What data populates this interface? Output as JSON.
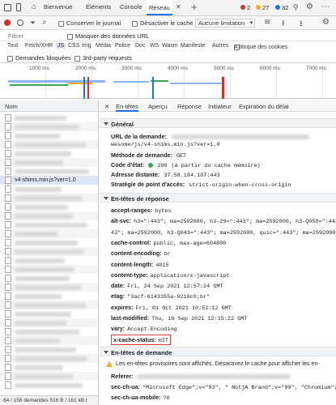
{
  "topbar": {
    "tabs": [
      "Bienvenue",
      "Éléments",
      "Console",
      "Réseau"
    ],
    "active_tab": "Réseau",
    "errors": "2",
    "warnings": "27",
    "info": "32"
  },
  "toolbar": {
    "preserve_log": "Conserver le journal",
    "disable_cache": "Désactiver le cache",
    "throttle": "Aucune limitation"
  },
  "filter": {
    "placeholder": "Filtrer",
    "hide_data_urls": "Masquer des données URL"
  },
  "types": [
    "Tout",
    "Fetch/XHR",
    "JS",
    "CSS",
    "Img",
    "Média",
    "Police",
    "Doc",
    "WS",
    "Wasm",
    "Manifeste",
    "Autres"
  ],
  "types_selected": "JS",
  "blocked_cookies": "A bloqué des cookies",
  "blocked_requests": "Demandes bloquées",
  "third_party": "3rd-party requests",
  "timeline": {
    "labels": [
      "1000 ms",
      "2000 ms",
      "3000 ms",
      "4000 ms",
      "5000 ms",
      "6000 ms",
      "7000 ms"
    ]
  },
  "left": {
    "column_header": "Nom",
    "selected_file": "v4-shims.min.js?ver=1.0",
    "status": "64 / 156 demandes   516 B / 161 kB t"
  },
  "right": {
    "tabs": [
      "En-têtes",
      "Aperçu",
      "Réponse",
      "Initiateur",
      "Expiration du délai"
    ],
    "active_tab": "En-têtes",
    "general": {
      "title": "Général",
      "url_label": "URL de la demande:",
      "url_value": "wesome/js/v4-shims.min.js?ver=1.0",
      "method_label": "Méthode de demande:",
      "method_value": "GET",
      "status_label": "Code d'état:",
      "status_code": "200",
      "status_note": "(à partir du cache mémoire)",
      "remote_label": "Adresse distante:",
      "remote_value": "37.58.184.107:443",
      "referrer_label": "Stratégie de point d'accès:",
      "referrer_value": "strict-origin-when-cross-origin"
    },
    "response": {
      "title": "En-têtes de réponse",
      "headers": [
        {
          "k": "accept-ranges:",
          "v": "bytes"
        },
        {
          "k": "alt-svc:",
          "v": "h3=\":443\"; ma=2592000, h3-29=\":443\"; ma=2592000, h3-Q050=\":443\"; ma=2"
        },
        {
          "k": "",
          "v": "43\"; ma=2592000, h3-Q043=\":443\"; ma=2592000, quic=\":443\"; ma=2592000; v=\"46,4"
        },
        {
          "k": "cache-control:",
          "v": "public, max-age=604800"
        },
        {
          "k": "content-encoding:",
          "v": "br"
        },
        {
          "k": "content-length:",
          "v": "4015"
        },
        {
          "k": "content-type:",
          "v": "application/x-javascript"
        },
        {
          "k": "date:",
          "v": "Fri, 24 Sep 2021 12:57:24 GMT"
        },
        {
          "k": "etag:",
          "v": "\"3acf-6143355a-9216c0;br\""
        },
        {
          "k": "expires:",
          "v": "Fri, 01 Oct 2021 10:52:12 GMT"
        },
        {
          "k": "last-modified:",
          "v": "Thu, 16 Sep 2021 12:15:22 GMT"
        },
        {
          "k": "vary:",
          "v": "Accept-Encoding"
        },
        {
          "k": "x-cache-status:",
          "v": "HIT"
        }
      ]
    },
    "request": {
      "title": "En-têtes de demande",
      "warning": "Les en-têtes provisoires sont affichés. Désactivez le cache pour afficher les en-",
      "headers": [
        {
          "k": "Referer:",
          "v": ""
        },
        {
          "k": "sec-ch-ua:",
          "v": "\"Microsoft Edge\";v=\"93\", \" NotjA Brand\";v=\"99\", \"Chromium\";v="
        },
        {
          "k": "sec-ch-ua-mobile:",
          "v": "?0"
        }
      ]
    }
  },
  "colors": {
    "accent": "#1a73e8",
    "error": "#d93025",
    "warning": "#f9a825",
    "highlight": "#e53935"
  }
}
